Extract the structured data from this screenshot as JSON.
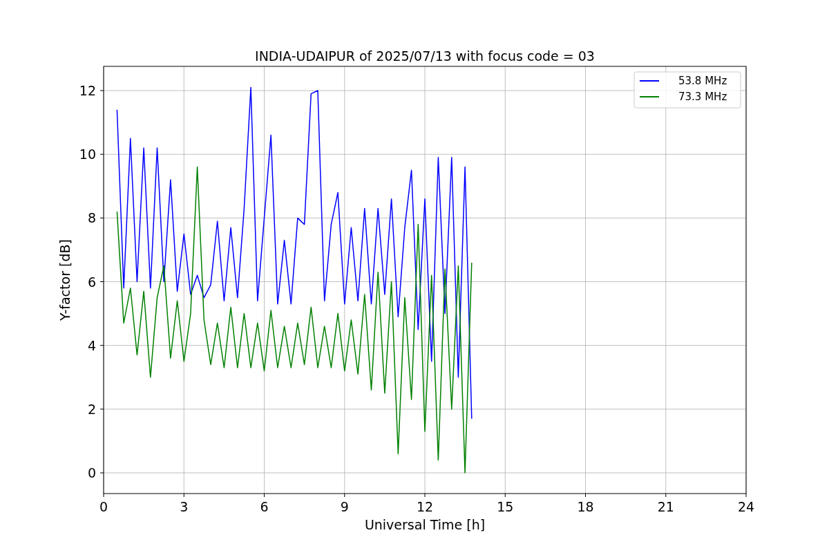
{
  "figure": {
    "chart_data": {
      "type": "line",
      "title": "INDIA-UDAIPUR of 2025/07/13 with focus code = 03",
      "xlabel": "Universal Time [h]",
      "ylabel": "Y-factor [dB]",
      "x": [
        0.5,
        0.75,
        1.0,
        1.25,
        1.5,
        1.75,
        2.0,
        2.25,
        2.5,
        2.75,
        3.0,
        3.25,
        3.5,
        3.75,
        4.0,
        4.25,
        4.5,
        4.75,
        5.0,
        5.25,
        5.5,
        5.75,
        6.0,
        6.25,
        6.5,
        6.75,
        7.0,
        7.25,
        7.5,
        7.75,
        8.0,
        8.25,
        8.5,
        8.75,
        9.0,
        9.25,
        9.5,
        9.75,
        10.0,
        10.25,
        10.5,
        10.75,
        11.0,
        11.25,
        11.5,
        11.75,
        12.0,
        12.25,
        12.5,
        12.75,
        13.0,
        13.25,
        13.5,
        13.75
      ],
      "series": [
        {
          "name": "53.8 MHz",
          "color": "#0000ff",
          "values": [
            11.4,
            5.8,
            10.5,
            6.0,
            10.2,
            5.8,
            10.2,
            6.0,
            9.2,
            5.7,
            7.5,
            5.6,
            6.2,
            5.5,
            5.9,
            7.9,
            5.4,
            7.7,
            5.5,
            8.3,
            12.1,
            5.4,
            8.0,
            10.6,
            5.3,
            7.3,
            5.3,
            8.0,
            7.8,
            11.9,
            12.0,
            5.4,
            7.8,
            8.8,
            5.3,
            7.7,
            5.4,
            8.3,
            5.3,
            8.3,
            5.6,
            8.6,
            4.9,
            7.7,
            9.5,
            4.5,
            8.6,
            3.5,
            9.9,
            5.0,
            9.9,
            3.0,
            9.6,
            1.7
          ]
        },
        {
          "name": "73.3 MHz",
          "color": "#008000",
          "values": [
            8.2,
            4.7,
            5.8,
            3.7,
            5.7,
            3.0,
            5.5,
            6.5,
            3.6,
            5.4,
            3.5,
            5.0,
            9.6,
            4.8,
            3.4,
            4.7,
            3.3,
            5.2,
            3.3,
            5.0,
            3.3,
            4.7,
            3.2,
            5.1,
            3.3,
            4.6,
            3.3,
            4.7,
            3.4,
            5.2,
            3.3,
            4.6,
            3.3,
            5.0,
            3.2,
            4.8,
            3.1,
            5.6,
            2.6,
            6.3,
            2.5,
            6.0,
            0.6,
            5.5,
            2.3,
            7.8,
            1.3,
            6.2,
            0.4,
            6.4,
            2.0,
            6.5,
            0.0,
            6.6
          ]
        }
      ],
      "grid": true,
      "legend": true,
      "xlim": [
        0,
        24
      ],
      "ylim": [
        -0.65,
        12.76
      ],
      "xticks": [
        0,
        3,
        6,
        9,
        12,
        15,
        18,
        21,
        24
      ],
      "yticks": [
        0,
        2,
        4,
        6,
        8,
        10,
        12
      ]
    }
  }
}
